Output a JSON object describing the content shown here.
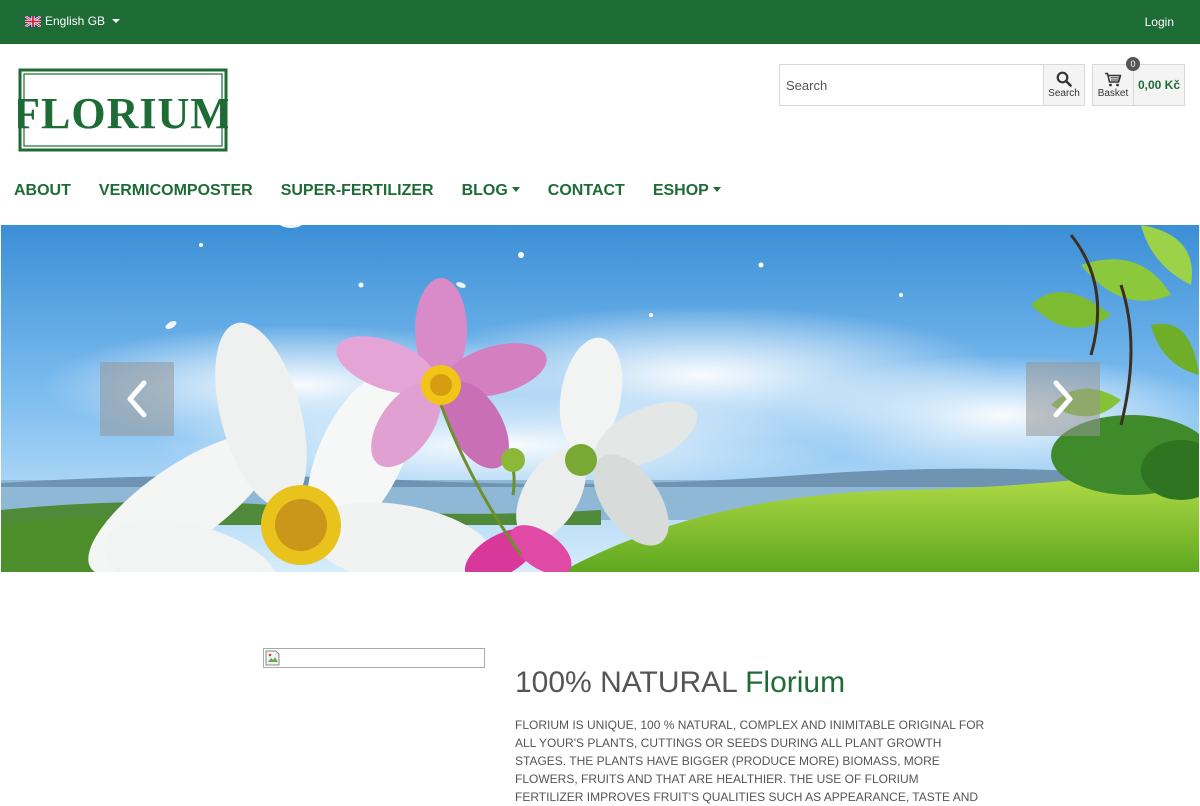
{
  "topbar": {
    "language": "English GB",
    "login": "Login"
  },
  "header": {
    "logo_text": "FLORIUM",
    "search": {
      "placeholder": "Search",
      "button_label": "Search"
    },
    "basket": {
      "label": "Basket",
      "count": "0",
      "total": "0,00 Kč"
    }
  },
  "nav": {
    "items": [
      {
        "label": "ABOUT"
      },
      {
        "label": "VERMICOMPOSTER"
      },
      {
        "label": "SUPER-FERTILIZER"
      },
      {
        "label": "BLOG"
      },
      {
        "label": "CONTACT"
      },
      {
        "label": "ESHOP"
      }
    ]
  },
  "content": {
    "headline_main": "100% NATURAL ",
    "headline_accent": "Florium",
    "paragraph": "FLORIUM IS UNIQUE, 100 % NATURAL, COMPLEX AND INIMITABLE ORIGINAL FOR ALL YOUR'S PLANTS, CUTTINGS OR SEEDS DURING ALL PLANT GROWTH STAGES. THE PLANTS HAVE BIGGER (PRODUCE MORE) BIOMASS, MORE FLOWERS, FRUITS AND THAT ARE HEALTHIER. THE USE OF FLORIUM FERTILIZER IMPROVES FRUIT'S QUALITIES SUCH AS APPEARANCE, TASTE AND"
  },
  "colors": {
    "brand_green": "#1d6b35"
  },
  "icons": [
    "uk-flag-icon",
    "search-icon",
    "basket-icon",
    "chevron-left-icon",
    "chevron-right-icon",
    "broken-image-icon"
  ]
}
